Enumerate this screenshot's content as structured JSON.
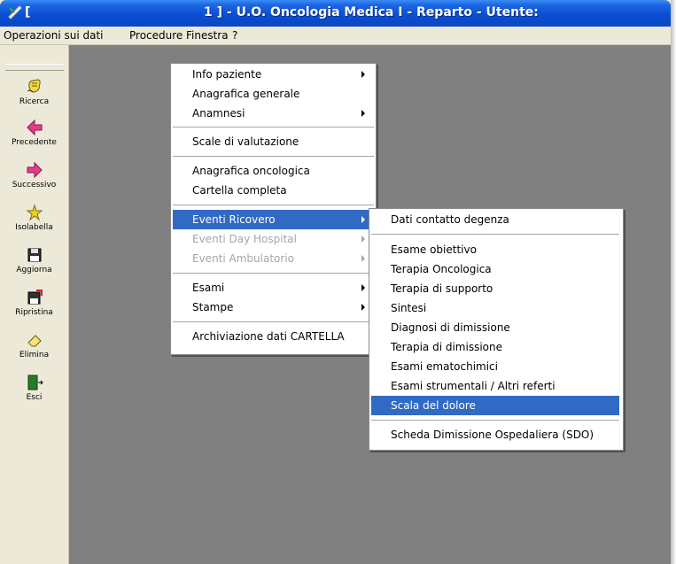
{
  "titlebar": {
    "left_text": "[",
    "title": "1 ] - U.O. Oncologia Medica I - Reparto -  Utente:"
  },
  "menubar": {
    "items": [
      "Operazioni sui dati",
      "Procedure",
      "Finestra",
      "?"
    ]
  },
  "toolbar": {
    "buttons": [
      {
        "label": "Ricerca",
        "icon": "hand-search-icon"
      },
      {
        "label": "Precedente",
        "icon": "arrow-left-icon"
      },
      {
        "label": "Successivo",
        "icon": "arrow-right-icon"
      },
      {
        "label": "Isolabella",
        "icon": "star-icon"
      },
      {
        "label": "Aggiorna",
        "icon": "floppy-icon"
      },
      {
        "label": "Ripristina",
        "icon": "floppy-restore-icon"
      },
      {
        "label": "Elimina",
        "icon": "eraser-icon"
      },
      {
        "label": "Esci",
        "icon": "exit-door-icon"
      }
    ]
  },
  "procedure_menu": {
    "items": [
      {
        "label": "Info paziente",
        "submenu": true
      },
      {
        "label": "Anagrafica generale"
      },
      {
        "label": "Anamnesi",
        "submenu": true
      },
      {
        "label": "Scale di valutazione"
      },
      {
        "label": "Anagrafica oncologica"
      },
      {
        "label": "Cartella completa"
      },
      {
        "label": "Eventi Ricovero",
        "submenu": true,
        "state": "active"
      },
      {
        "label": "Eventi Day Hospital",
        "submenu": true,
        "state": "disabled"
      },
      {
        "label": "Eventi Ambulatorio",
        "submenu": true,
        "state": "disabled"
      },
      {
        "label": "Esami",
        "submenu": true
      },
      {
        "label": "Stampe",
        "submenu": true
      },
      {
        "label": "Archiviazione dati CARTELLA"
      }
    ]
  },
  "ricovero_submenu": {
    "items": [
      {
        "label": "Dati contatto degenza"
      },
      {
        "label": "Esame obiettivo"
      },
      {
        "label": "Terapia Oncologica"
      },
      {
        "label": "Terapia di supporto"
      },
      {
        "label": "Sintesi"
      },
      {
        "label": "Diagnosi di dimissione"
      },
      {
        "label": "Terapia di dimissione"
      },
      {
        "label": "Esami ematochimici"
      },
      {
        "label": "Esami strumentali / Altri referti"
      },
      {
        "label": "Scala del dolore",
        "state": "active"
      },
      {
        "label": "Scheda Dimissione Ospedaliera (SDO)"
      }
    ]
  },
  "colors": {
    "title_blue": "#0a4fd4",
    "highlight": "#316ac5",
    "workspace": "#808080",
    "chrome": "#ece9d8"
  }
}
